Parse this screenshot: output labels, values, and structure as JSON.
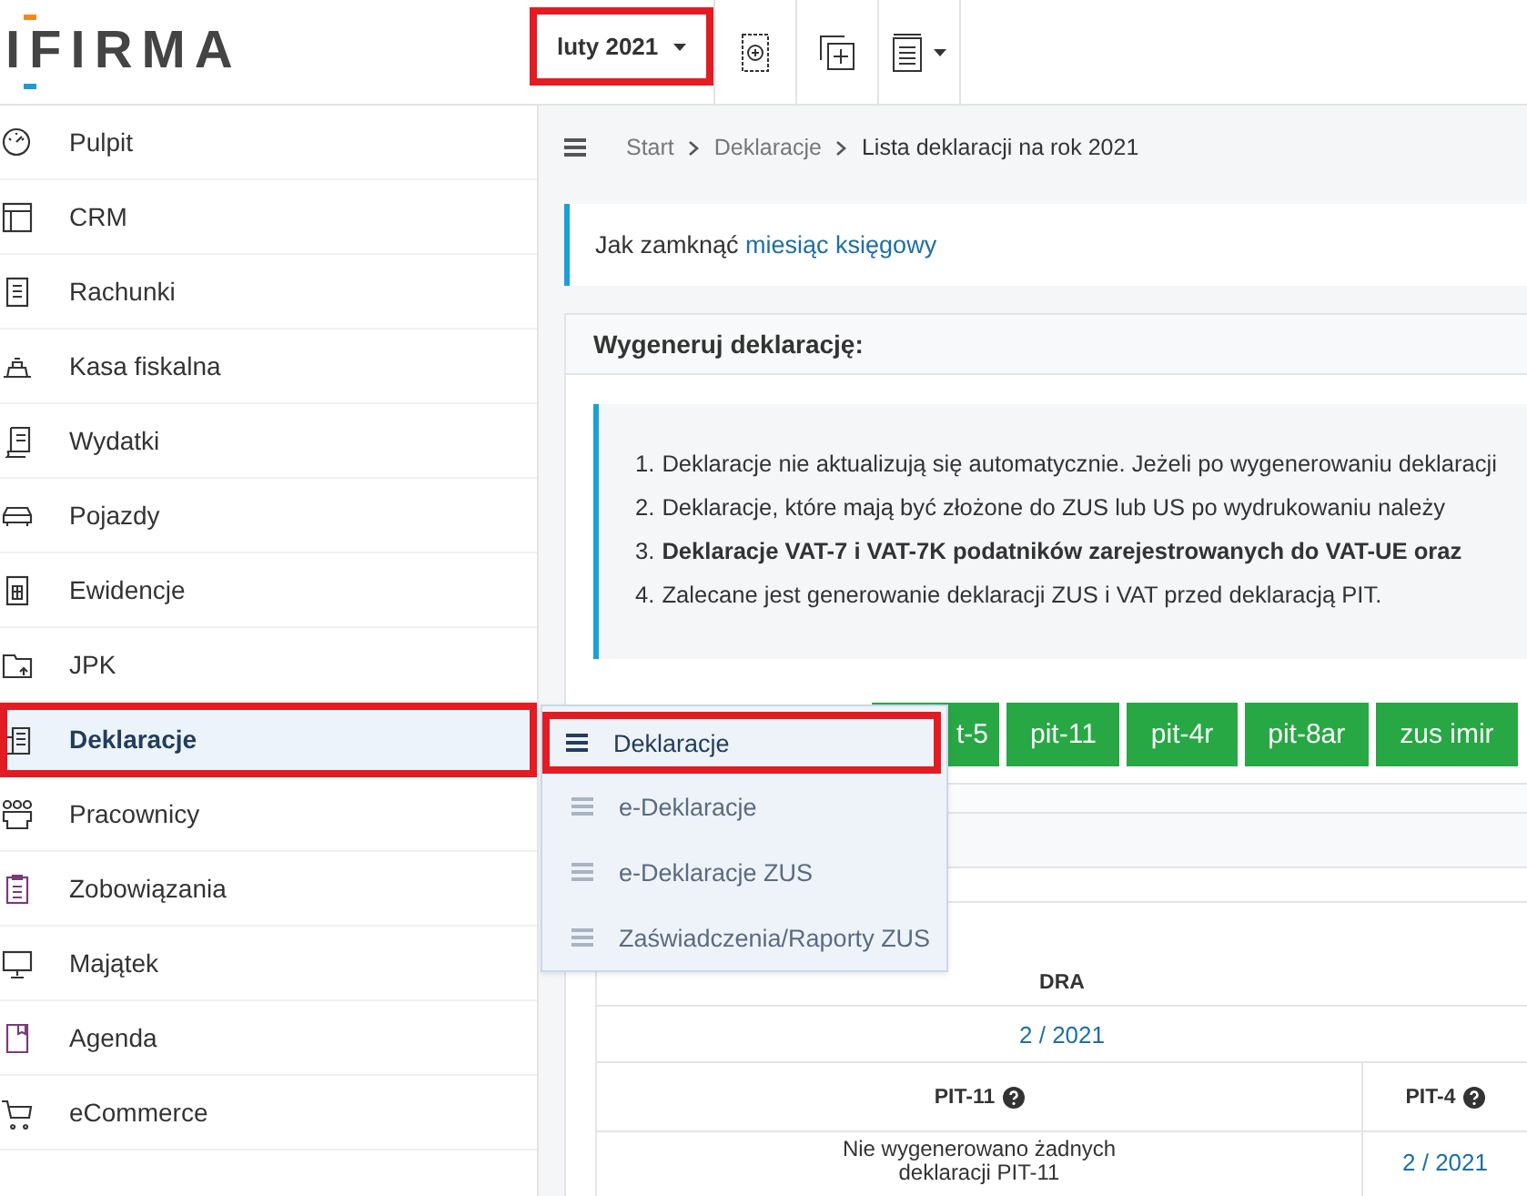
{
  "header": {
    "logo": "IFIRMA",
    "period": {
      "label": "luty 2021",
      "highlighted": true
    }
  },
  "sidebar": {
    "items": [
      {
        "label": "Pulpit",
        "selected": false,
        "highlighted": false
      },
      {
        "label": "CRM",
        "selected": false,
        "highlighted": false
      },
      {
        "label": "Rachunki",
        "selected": false,
        "highlighted": false
      },
      {
        "label": "Kasa fiskalna",
        "selected": false,
        "highlighted": false
      },
      {
        "label": "Wydatki",
        "selected": false,
        "highlighted": false
      },
      {
        "label": "Pojazdy",
        "selected": false,
        "highlighted": false
      },
      {
        "label": "Ewidencje",
        "selected": false,
        "highlighted": false
      },
      {
        "label": "JPK",
        "selected": false,
        "highlighted": false
      },
      {
        "label": "Deklaracje",
        "selected": true,
        "highlighted": true
      },
      {
        "label": "Pracownicy",
        "selected": false,
        "highlighted": false
      },
      {
        "label": "Zobowiązania",
        "selected": false,
        "highlighted": false
      },
      {
        "label": "Majątek",
        "selected": false,
        "highlighted": false
      },
      {
        "label": "Agenda",
        "selected": false,
        "highlighted": false
      },
      {
        "label": "eCommerce",
        "selected": false,
        "highlighted": false
      }
    ]
  },
  "breadcrumb": [
    {
      "label": "Start",
      "current": false
    },
    {
      "label": "Deklaracje",
      "current": false
    },
    {
      "label": "Lista deklaracji na rok 2021",
      "current": true
    }
  ],
  "info": {
    "text": "Jak zamknąć",
    "link": "miesiąc księgowy"
  },
  "generate_card": {
    "title": "Wygeneruj deklarację:",
    "notes": [
      {
        "number": "1.",
        "text": "Deklaracje nie aktualizują się automatycznie. Jeżeli po wygenerowaniu deklaracji",
        "bold": false
      },
      {
        "number": "2.",
        "text": "Deklaracje, które mają być złożone do ZUS lub US po wydrukowaniu należy",
        "bold": false
      },
      {
        "number": "3.",
        "text": "Deklaracje VAT-7 i VAT-7K podatników zarejestrowanych do VAT-UE oraz",
        "bold": true
      },
      {
        "number": "4.",
        "text": "Zalecane jest generowanie deklaracji ZUS i VAT przed deklaracją PIT.",
        "bold": false
      }
    ],
    "buttons": [
      "t-5",
      "pit-11",
      "pit-4r",
      "pit-8ar",
      "zus imir"
    ]
  },
  "submenu": [
    {
      "label": "Deklaracje",
      "selected": true,
      "highlighted": true
    },
    {
      "label": "e-Deklaracje",
      "selected": false,
      "highlighted": false
    },
    {
      "label": "e-Deklaracje ZUS",
      "selected": false,
      "highlighted": false
    },
    {
      "label": "Zaświadczenia/Raporty ZUS",
      "selected": false,
      "highlighted": false
    }
  ],
  "table": {
    "title": "DRA",
    "period": "2 / 2021",
    "columns": [
      "PIT-11",
      "PIT-4"
    ],
    "rows": [
      [
        {
          "kind": "text",
          "text": "Nie wygenerowano żadnych deklaracji PIT-11"
        },
        {
          "kind": "link",
          "text": "2 / 2021"
        }
      ]
    ]
  }
}
